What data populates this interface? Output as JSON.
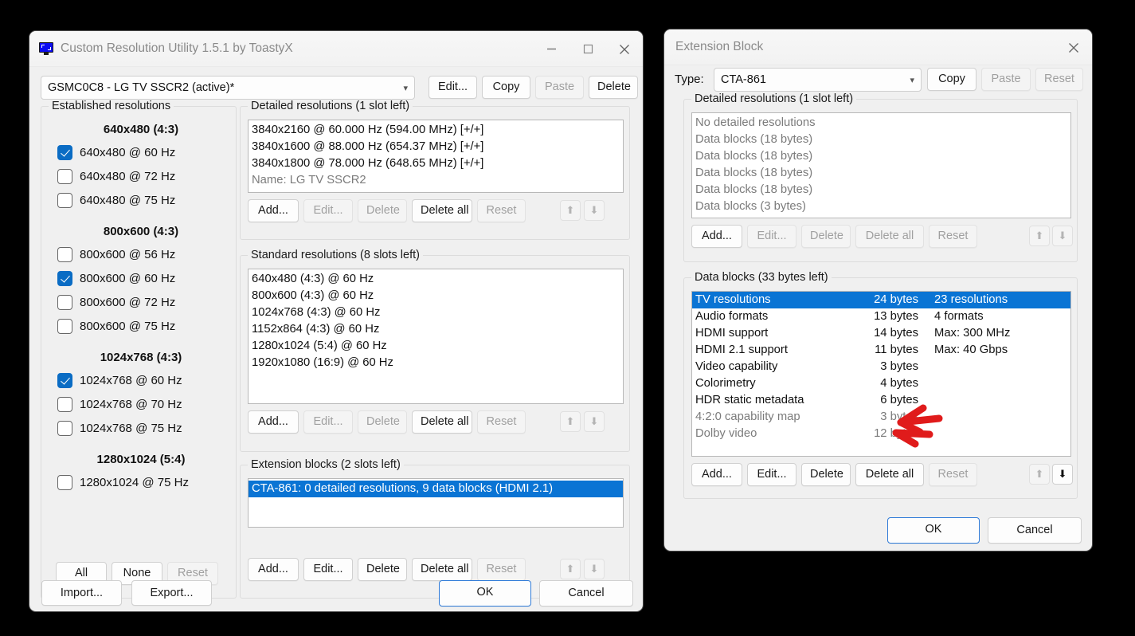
{
  "main_window": {
    "title": "Custom Resolution Utility 1.5.1 by ToastyX",
    "icon": "monitor-icon",
    "minimize_label": "—",
    "maximize_label": "□",
    "close_label": "✕",
    "display_combo": {
      "value": "GSMC0C8 - LG TV SSCR2 (active)*",
      "chevron": "chevron-down-icon"
    },
    "top_buttons": [
      {
        "label": "Edit...",
        "disabled": false
      },
      {
        "label": "Copy",
        "disabled": false
      },
      {
        "label": "Paste",
        "disabled": true
      },
      {
        "label": "Delete",
        "disabled": false
      }
    ],
    "established": {
      "legend": "Established resolutions",
      "sections": [
        {
          "header": "640x480 (4:3)",
          "items": [
            {
              "label": "640x480 @ 60 Hz",
              "checked": true
            },
            {
              "label": "640x480 @ 72 Hz",
              "checked": false
            },
            {
              "label": "640x480 @ 75 Hz",
              "checked": false
            }
          ]
        },
        {
          "header": "800x600 (4:3)",
          "items": [
            {
              "label": "800x600 @ 56 Hz",
              "checked": false
            },
            {
              "label": "800x600 @ 60 Hz",
              "checked": true
            },
            {
              "label": "800x600 @ 72 Hz",
              "checked": false
            },
            {
              "label": "800x600 @ 75 Hz",
              "checked": false
            }
          ]
        },
        {
          "header": "1024x768 (4:3)",
          "items": [
            {
              "label": "1024x768 @ 60 Hz",
              "checked": true
            },
            {
              "label": "1024x768 @ 70 Hz",
              "checked": false
            },
            {
              "label": "1024x768 @ 75 Hz",
              "checked": false
            }
          ]
        },
        {
          "header": "1280x1024 (5:4)",
          "items": [
            {
              "label": "1280x1024 @ 75 Hz",
              "checked": false
            }
          ]
        }
      ],
      "buttons": [
        {
          "label": "All",
          "disabled": false
        },
        {
          "label": "None",
          "disabled": false
        },
        {
          "label": "Reset",
          "disabled": true
        }
      ]
    },
    "detailed": {
      "legend": "Detailed resolutions (1 slot left)",
      "rows": [
        {
          "text": "3840x2160 @ 60.000 Hz (594.00 MHz) [+/+]",
          "muted": false
        },
        {
          "text": "3840x1600 @ 88.000 Hz (654.37 MHz) [+/+]",
          "muted": false
        },
        {
          "text": "3840x1800 @ 78.000 Hz (648.65 MHz) [+/+]",
          "muted": false
        },
        {
          "text": "Name: LG TV SSCR2",
          "muted": true
        }
      ],
      "buttons": [
        {
          "label": "Add...",
          "disabled": false
        },
        {
          "label": "Edit...",
          "disabled": true
        },
        {
          "label": "Delete",
          "disabled": true
        },
        {
          "label": "Delete all",
          "disabled": false
        },
        {
          "label": "Reset",
          "disabled": true
        }
      ],
      "up_icon": "arrow-up-icon",
      "down_icon": "arrow-down-icon"
    },
    "standard": {
      "legend": "Standard resolutions (8 slots left)",
      "rows": [
        {
          "text": "640x480 (4:3) @ 60 Hz",
          "muted": false
        },
        {
          "text": "800x600 (4:3) @ 60 Hz",
          "muted": false
        },
        {
          "text": "1024x768 (4:3) @ 60 Hz",
          "muted": false
        },
        {
          "text": "1152x864 (4:3) @ 60 Hz",
          "muted": false
        },
        {
          "text": "1280x1024 (5:4) @ 60 Hz",
          "muted": false
        },
        {
          "text": "1920x1080 (16:9) @ 60 Hz",
          "muted": false
        }
      ],
      "buttons": [
        {
          "label": "Add...",
          "disabled": false
        },
        {
          "label": "Edit...",
          "disabled": true
        },
        {
          "label": "Delete",
          "disabled": true
        },
        {
          "label": "Delete all",
          "disabled": false
        },
        {
          "label": "Reset",
          "disabled": true
        }
      ],
      "up_icon": "arrow-up-icon",
      "down_icon": "arrow-down-icon"
    },
    "extension_blocks": {
      "legend": "Extension blocks (2 slots left)",
      "rows": [
        {
          "text": "CTA-861: 0 detailed resolutions, 9 data blocks (HDMI 2.1)",
          "selected": true
        }
      ],
      "buttons": [
        {
          "label": "Add...",
          "disabled": false
        },
        {
          "label": "Edit...",
          "disabled": false
        },
        {
          "label": "Delete",
          "disabled": false
        },
        {
          "label": "Delete all",
          "disabled": false
        },
        {
          "label": "Reset",
          "disabled": true
        }
      ],
      "up_icon": "arrow-up-icon",
      "down_icon": "arrow-down-icon"
    },
    "footer": {
      "import_label": "Import...",
      "export_label": "Export...",
      "ok_label": "OK",
      "cancel_label": "Cancel"
    }
  },
  "extension_window": {
    "title": "Extension Block",
    "close_label": "✕",
    "type_label": "Type:",
    "type_combo": {
      "value": "CTA-861",
      "chevron": "chevron-down-icon"
    },
    "header_buttons": [
      {
        "label": "Copy",
        "disabled": false
      },
      {
        "label": "Paste",
        "disabled": true
      },
      {
        "label": "Reset",
        "disabled": true
      }
    ],
    "detailed": {
      "legend": "Detailed resolutions (1 slot left)",
      "rows": [
        {
          "text": "No detailed resolutions",
          "muted": true
        },
        {
          "text": "Data blocks (18 bytes)",
          "muted": true
        },
        {
          "text": "Data blocks (18 bytes)",
          "muted": true
        },
        {
          "text": "Data blocks (18 bytes)",
          "muted": true
        },
        {
          "text": "Data blocks (18 bytes)",
          "muted": true
        },
        {
          "text": "Data blocks (3 bytes)",
          "muted": true
        }
      ],
      "buttons": [
        {
          "label": "Add...",
          "disabled": false
        },
        {
          "label": "Edit...",
          "disabled": true
        },
        {
          "label": "Delete",
          "disabled": true
        },
        {
          "label": "Delete all",
          "disabled": true
        },
        {
          "label": "Reset",
          "disabled": true
        }
      ],
      "up_icon": "arrow-up-icon",
      "down_icon": "arrow-down-icon"
    },
    "data_blocks": {
      "legend": "Data blocks (33 bytes left)",
      "rows": [
        {
          "name": "TV resolutions",
          "size": "24 bytes",
          "info": "23 resolutions",
          "selected": true,
          "muted": false
        },
        {
          "name": "Audio formats",
          "size": "13 bytes",
          "info": "4 formats",
          "selected": false,
          "muted": false
        },
        {
          "name": "HDMI support",
          "size": "14 bytes",
          "info": "Max: 300 MHz",
          "selected": false,
          "muted": false
        },
        {
          "name": "HDMI 2.1 support",
          "size": "11 bytes",
          "info": "Max: 40 Gbps",
          "selected": false,
          "muted": false
        },
        {
          "name": "Video capability",
          "size": "3 bytes",
          "info": "",
          "selected": false,
          "muted": false
        },
        {
          "name": "Colorimetry",
          "size": "4 bytes",
          "info": "",
          "selected": false,
          "muted": false
        },
        {
          "name": "HDR static metadata",
          "size": "6 bytes",
          "info": "",
          "selected": false,
          "muted": false
        },
        {
          "name": "4:2:0 capability map",
          "size": "3 bytes",
          "info": "",
          "selected": false,
          "muted": true
        },
        {
          "name": "Dolby video",
          "size": "12 bytes",
          "info": "",
          "selected": false,
          "muted": true
        }
      ],
      "buttons": [
        {
          "label": "Add...",
          "disabled": false
        },
        {
          "label": "Edit...",
          "disabled": false
        },
        {
          "label": "Delete",
          "disabled": false
        },
        {
          "label": "Delete all",
          "disabled": false
        },
        {
          "label": "Reset",
          "disabled": true
        }
      ],
      "up_icon": "arrow-up-icon",
      "down_icon": "arrow-down-icon"
    },
    "footer": {
      "ok_label": "OK",
      "cancel_label": "Cancel"
    }
  },
  "annotation": {
    "type": "red-double-arrow",
    "color": "#e01b1b",
    "points_at": "4:2:0 capability map / Dolby video rows"
  }
}
